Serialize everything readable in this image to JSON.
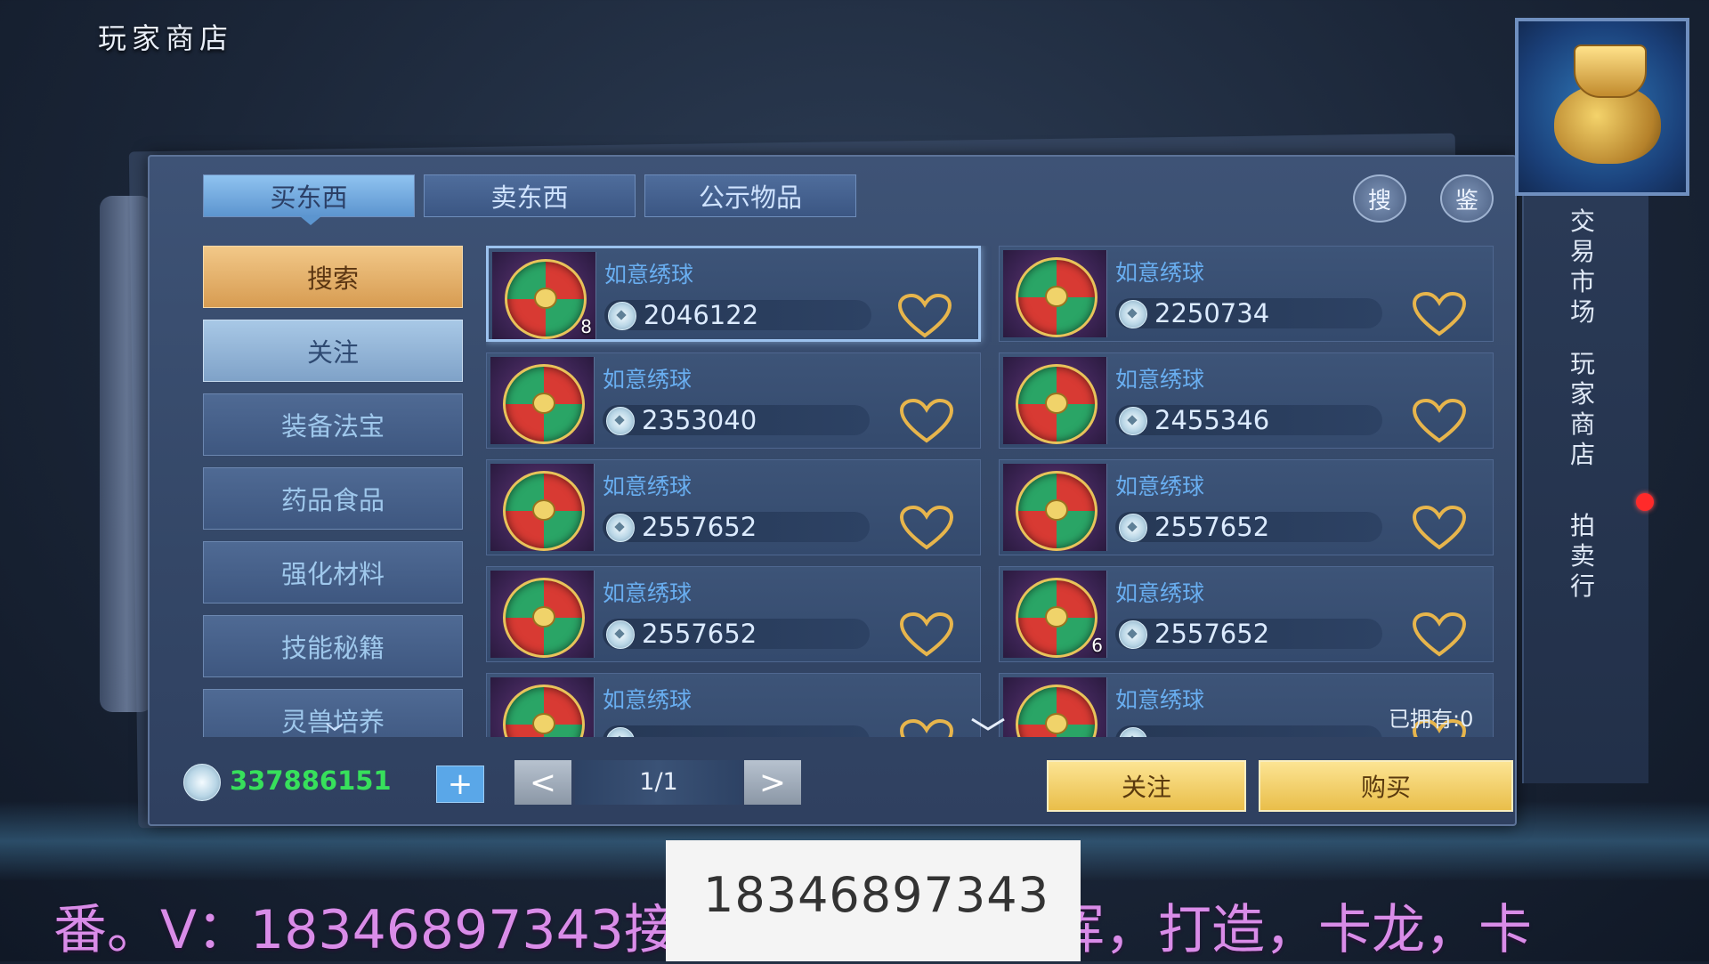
{
  "window": {
    "title": "玩家商店"
  },
  "tabs": [
    {
      "label": "买东西"
    },
    {
      "label": "卖东西"
    },
    {
      "label": "公示物品"
    }
  ],
  "top_icons": {
    "search_label": "搜",
    "appraise_label": "鉴"
  },
  "sidebar": {
    "items": [
      {
        "label": "搜索"
      },
      {
        "label": "关注"
      },
      {
        "label": "装备法宝"
      },
      {
        "label": "药品食品"
      },
      {
        "label": "强化材料"
      },
      {
        "label": "技能秘籍"
      },
      {
        "label": "灵兽培养"
      }
    ]
  },
  "items": [
    {
      "name": "如意绣球",
      "price": "2046122",
      "qty": "8"
    },
    {
      "name": "如意绣球",
      "price": "2250734",
      "qty": ""
    },
    {
      "name": "如意绣球",
      "price": "2353040",
      "qty": ""
    },
    {
      "name": "如意绣球",
      "price": "2455346",
      "qty": ""
    },
    {
      "name": "如意绣球",
      "price": "2557652",
      "qty": ""
    },
    {
      "name": "如意绣球",
      "price": "2557652",
      "qty": ""
    },
    {
      "name": "如意绣球",
      "price": "2557652",
      "qty": ""
    },
    {
      "name": "如意绣球",
      "price": "2557652",
      "qty": "6"
    },
    {
      "name": "如意绣球",
      "price": "",
      "qty": ""
    },
    {
      "name": "如意绣球",
      "price": "",
      "qty": ""
    }
  ],
  "owned": "已拥有:0",
  "footer": {
    "money": "337886151",
    "plus_label": "+",
    "prev_label": "<",
    "page": "1/1",
    "next_label": ">",
    "follow_button": "关注",
    "buy_button": "购买"
  },
  "right_tabs": [
    {
      "label": "交易市场"
    },
    {
      "label": "玩家商店"
    },
    {
      "label": "拍卖行"
    }
  ],
  "overlay": {
    "banner_text": "番。V：18346897343接托管，打架，指挥，打造，卡龙，卡",
    "box_text": "18346897343"
  },
  "colors": {
    "price_text": "#dcebff",
    "money_text": "#37e05b",
    "item_name": "#69aef0",
    "accent_gold": "#e9be4a"
  }
}
